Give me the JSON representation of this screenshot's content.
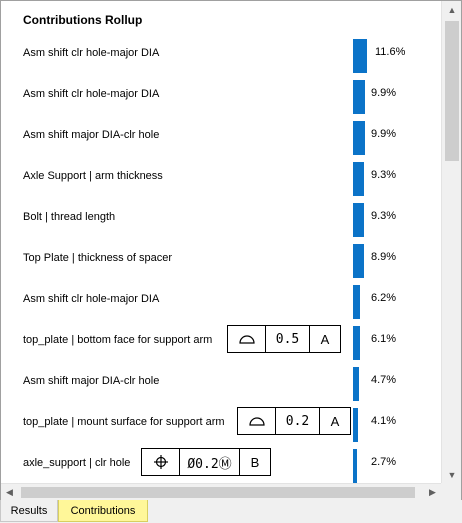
{
  "panel": {
    "title": "Contributions Rollup"
  },
  "rows": [
    {
      "label": "Asm shift clr hole-major DIA",
      "percent": "11.6%",
      "value": 0.116
    },
    {
      "label": "Asm shift clr hole-major DIA",
      "percent": "9.9%",
      "value": 0.099
    },
    {
      "label": "Asm shift major DIA-clr hole",
      "percent": "9.9%",
      "value": 0.099
    },
    {
      "label": "Axle Support | arm thickness",
      "percent": "9.3%",
      "value": 0.093
    },
    {
      "label": "Bolt | thread length",
      "percent": "9.3%",
      "value": 0.093
    },
    {
      "label": "Top Plate | thickness of spacer",
      "percent": "8.9%",
      "value": 0.089
    },
    {
      "label": "Asm shift clr hole-major DIA",
      "percent": "6.2%",
      "value": 0.062
    },
    {
      "label": "top_plate | bottom face for support arm",
      "percent": "6.1%",
      "value": 0.061,
      "fcf": {
        "symbol": "profile-of-surface-icon",
        "tolerance": "0.5",
        "datum": "A"
      }
    },
    {
      "label": "Asm shift major DIA-clr hole",
      "percent": "4.7%",
      "value": 0.047
    },
    {
      "label": "top_plate | mount surface for support arm",
      "percent": "4.1%",
      "value": 0.041,
      "fcf": {
        "symbol": "profile-of-surface-icon",
        "tolerance": "0.2",
        "datum": "A"
      }
    },
    {
      "label": "axle_support | clr hole",
      "percent": "2.7%",
      "value": 0.027,
      "fcf": {
        "symbol": "position-icon",
        "tolerance": "Ø0.2Ⓜ",
        "datum": "B"
      }
    }
  ],
  "tabs": [
    {
      "label": "Results",
      "active": false
    },
    {
      "label": "Contributions",
      "active": true
    }
  ],
  "colors": {
    "bar": "#0b73c8",
    "active_tab": "#fff799"
  }
}
